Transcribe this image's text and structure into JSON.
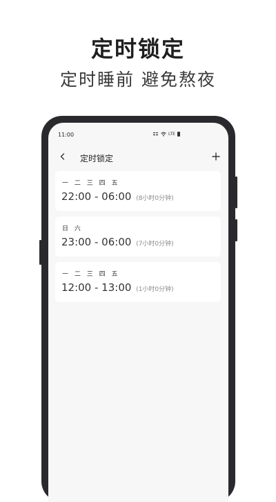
{
  "promo": {
    "headline": "定时锁定",
    "subline": "定时睡前 避免熬夜"
  },
  "status_bar": {
    "time": "11:00",
    "signal_text": "LTE"
  },
  "app_bar": {
    "title": "定时锁定",
    "back_icon": "chevron-left-icon",
    "add_icon": "plus-icon"
  },
  "schedules": [
    {
      "days": "一 二 三 四 五",
      "range": "22:00 - 06:00",
      "duration": "(8小时0分钟)"
    },
    {
      "days": "日 六",
      "range": "23:00 - 06:00",
      "duration": "(7小时0分钟)"
    },
    {
      "days": "一 二 三 四 五",
      "range": "12:00 - 13:00",
      "duration": "(1小时0分钟)"
    }
  ],
  "colors": {
    "screen_bg": "#f7f7f7",
    "card_bg": "#ffffff",
    "phone_frame": "#2a2a2e",
    "text_primary": "#333333",
    "text_secondary": "#8a8a8a"
  }
}
